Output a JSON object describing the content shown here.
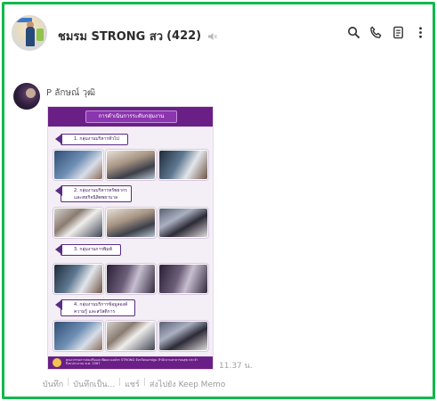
{
  "header": {
    "group_name": "ชมรม STRONG สว",
    "member_count": "(422)",
    "icons": [
      "mute-icon",
      "search-icon",
      "phone-icon",
      "notes-icon",
      "more-icon"
    ]
  },
  "message": {
    "sender": "P ลักษณ์ วุฒิ",
    "time": "11.37 น."
  },
  "poster": {
    "title": "การดำเนินการระดับกลุ่มงาน",
    "sections": [
      "1. กลุ่มงานบริหารทั่วไป",
      "2. กลุ่มงานบริหารทรัพยากร และสหกิจนิสิตพยาบาล",
      "3. กลุ่มงานการพิมพ์",
      "4. กลุ่มงานบริการข้อมูลองค์ความรู้ และสวัสดิการ"
    ],
    "footer": "คณะกรรมการส่งเสริมและพัฒนาองค์กร STRONG จังหวัดนครปฐม สำนักงานสาธารณสุข ประจำปีงบประมาณ พ.ศ. 2567"
  },
  "actions": [
    "บันทึก",
    "บันทึกเป็น...",
    "แชร์",
    "ส่งไปยัง Keep Memo"
  ],
  "colors": {
    "frame": "#12b84a",
    "poster_purple": "#6a1f86"
  }
}
